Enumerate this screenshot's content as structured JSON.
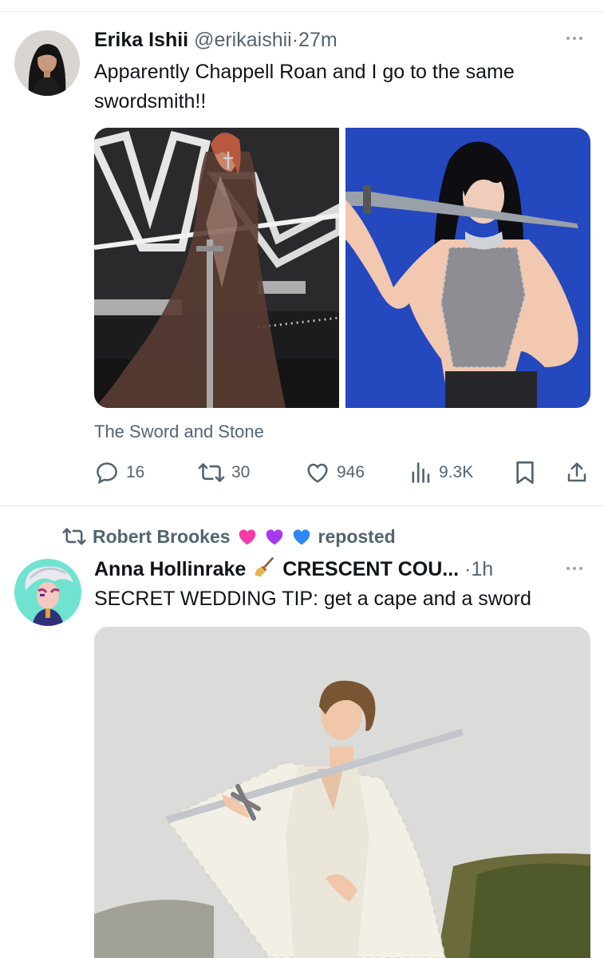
{
  "tweet1": {
    "name": "Erika Ishii",
    "handle": "@erikaishii",
    "dot": "·",
    "time": "27m",
    "text_line1": "Apparently Chappell Roan and I go to the same",
    "text_line2": "swordsmith!!",
    "card_caption": "The Sword and Stone",
    "stats": {
      "replies": "16",
      "reposts": "30",
      "likes": "946",
      "views": "9.3K"
    }
  },
  "repost_banner": {
    "name": "Robert Brookes",
    "emojis": [
      "pink-heart",
      "purple-heart",
      "blue-heart"
    ],
    "label": "reposted"
  },
  "tweet2": {
    "name": "Anna Hollinrake",
    "name_suffix": "CRESCENT COU...",
    "emoji": "broom",
    "dot": "·",
    "time": "1h",
    "text": "SECRET WEDDING TIP: get a cape and a sword"
  },
  "colors": {
    "text_primary": "#0f1419",
    "text_secondary": "#536471",
    "divider": "#eff3f4",
    "heart_pink": "#f33aa8",
    "heart_purple": "#a838f0",
    "heart_blue": "#2f86f0"
  }
}
